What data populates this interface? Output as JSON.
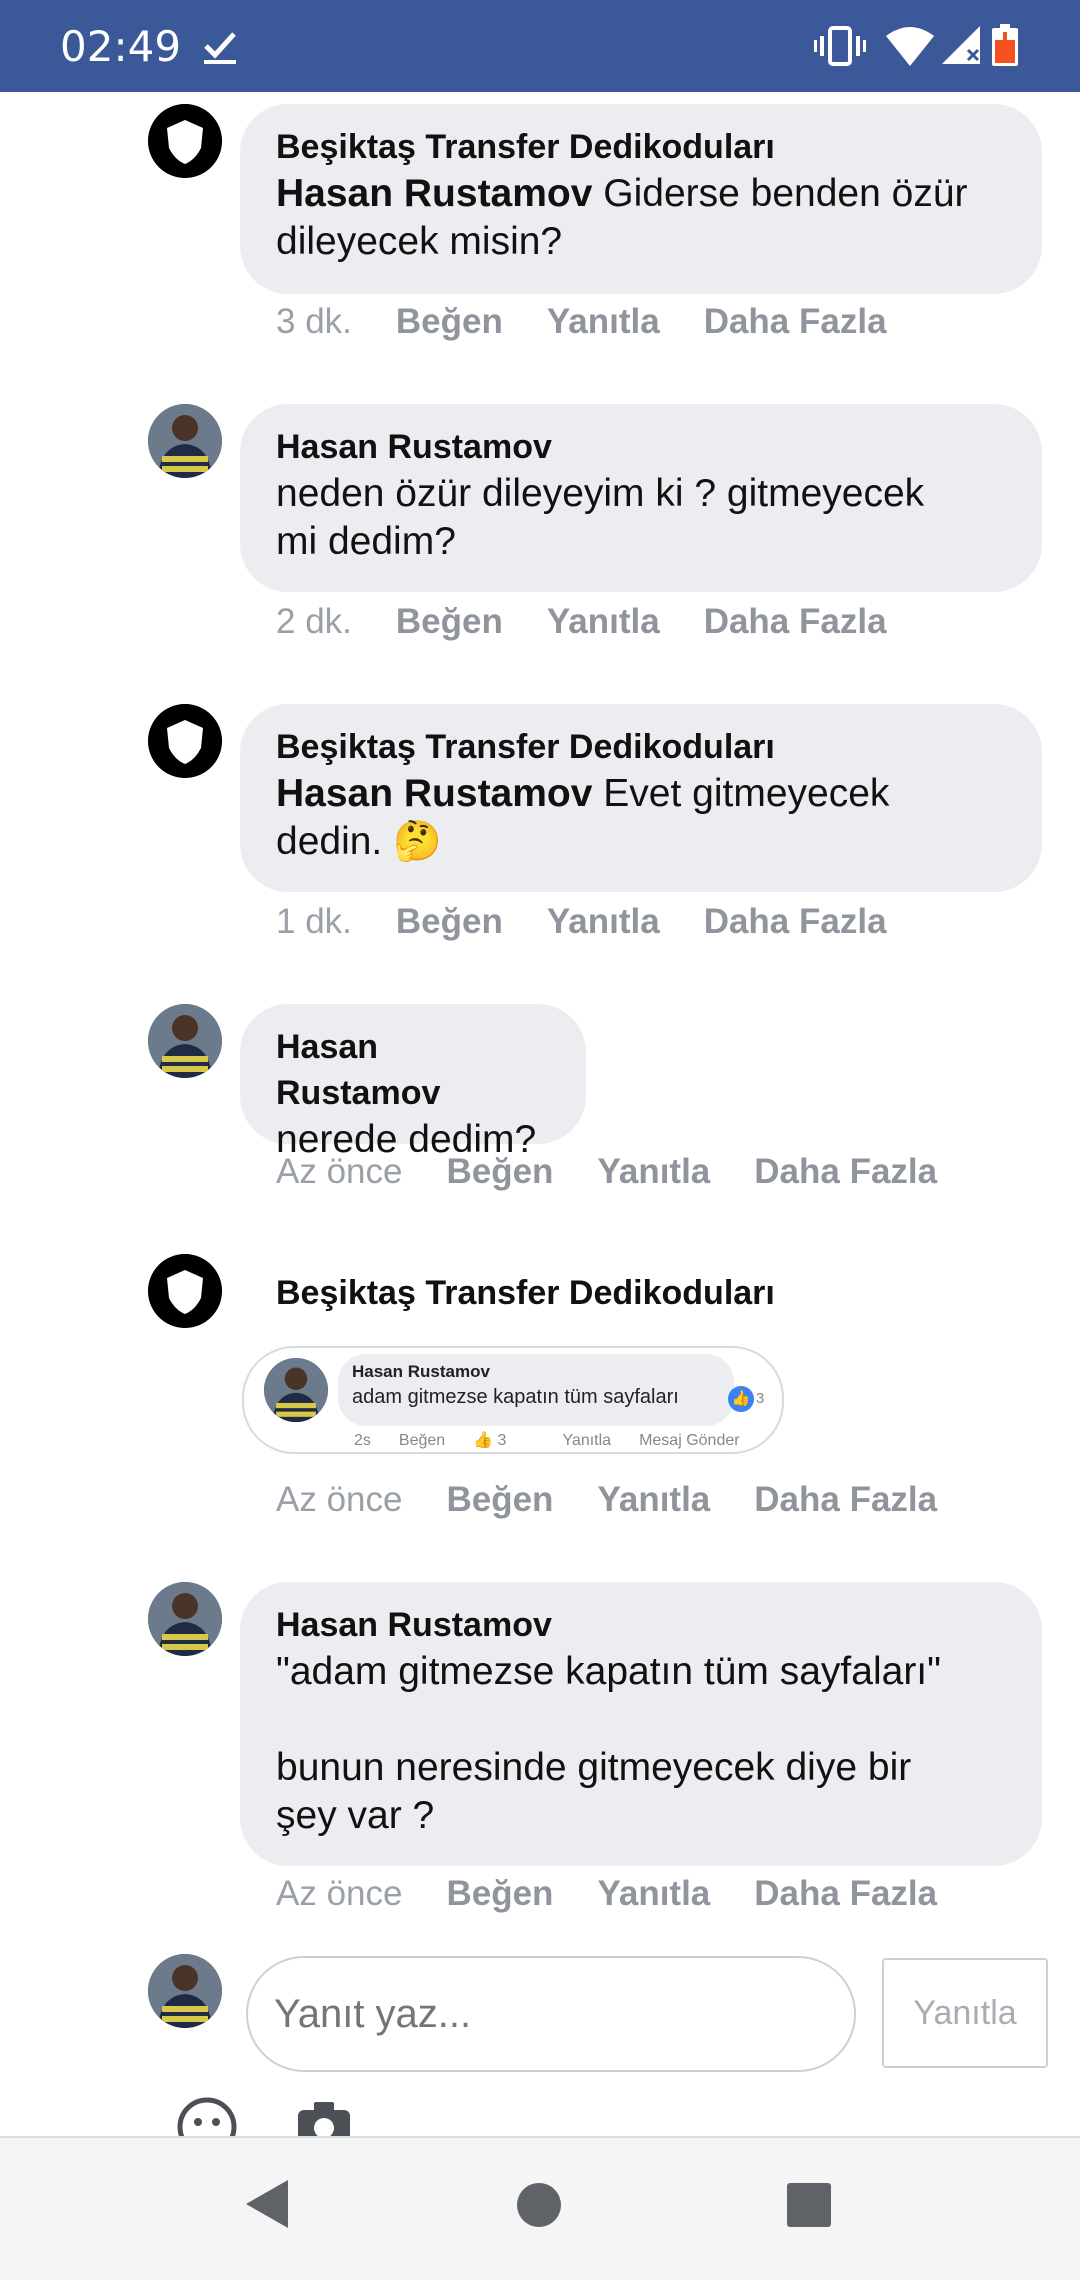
{
  "status_bar": {
    "time": "02:49",
    "icons": [
      "check-icon",
      "vibrate-icon",
      "wifi-icon",
      "signal-icon",
      "battery-low-icon"
    ],
    "background": "#3b5998"
  },
  "comments": [
    {
      "author": "Beşiktaş Transfer Dedikoduları",
      "avatar_type": "page",
      "mention": "Hasan Rustamov",
      "text": " Giderse benden özür\ndileyecek misin?",
      "time": "3 dk.",
      "like": "Beğen",
      "reply": "Yanıtla",
      "more": "Daha Fazla"
    },
    {
      "author": "Hasan Rustamov",
      "avatar_type": "user",
      "mention": "",
      "text": "neden özür dileyeyim ki ? gitmeyecek\nmi dedim?",
      "time": "2 dk.",
      "like": "Beğen",
      "reply": "Yanıtla",
      "more": "Daha Fazla"
    },
    {
      "author": "Beşiktaş Transfer Dedikoduları",
      "avatar_type": "page",
      "mention": "Hasan Rustamov",
      "text": " Evet gitmeyecek\ndedin. 🤔",
      "time": "1 dk.",
      "like": "Beğen",
      "reply": "Yanıtla",
      "more": "Daha Fazla"
    },
    {
      "author": "Hasan Rustamov",
      "avatar_type": "user",
      "mention": "",
      "text": "nerede dedim?",
      "time": "Az önce",
      "like": "Beğen",
      "reply": "Yanıtla",
      "more": "Daha Fazla"
    },
    {
      "author": "Beşiktaş Transfer Dedikoduları",
      "avatar_type": "page",
      "embedded_screenshot": {
        "author": "Hasan Rustamov",
        "text": "adam gitmezse kapatın tüm sayfaları",
        "reaction_count": "3",
        "actions": [
          "2s",
          "Beğen",
          "3",
          "Yanıtla",
          "Mesaj Gönder"
        ]
      },
      "time": "Az önce",
      "like": "Beğen",
      "reply": "Yanıtla",
      "more": "Daha Fazla"
    },
    {
      "author": "Hasan Rustamov",
      "avatar_type": "user",
      "mention": "",
      "text": "\"adam gitmezse kapatın tüm sayfaları\"\n\nbunun neresinde gitmeyecek diye bir\nşey var ?",
      "time": "Az önce",
      "like": "Beğen",
      "reply": "Yanıtla",
      "more": "Daha Fazla"
    }
  ],
  "composer": {
    "placeholder": "Yanıt yaz...",
    "button_label": "Yanıtla",
    "tools": [
      "emoji-icon",
      "camera-icon"
    ]
  },
  "navigation": [
    "back-icon",
    "home-icon",
    "recents-icon"
  ]
}
